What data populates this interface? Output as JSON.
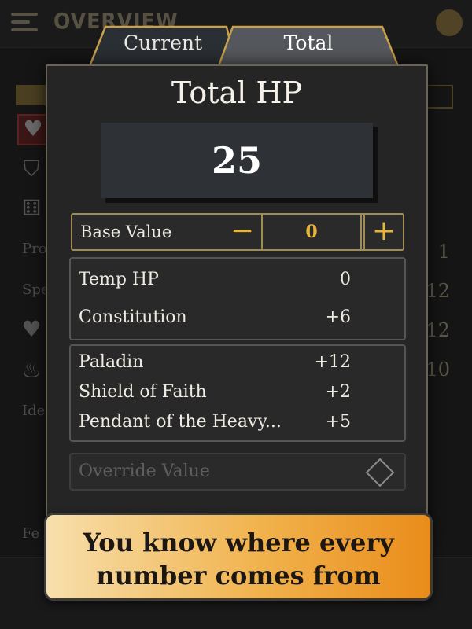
{
  "background": {
    "title": "OVERVIEW",
    "side_texts": [
      "Pro",
      "Spe",
      "Ide",
      "Fe"
    ],
    "side_numbers": [
      "1",
      "12",
      "12",
      "10"
    ]
  },
  "tabs": [
    {
      "label": "Current",
      "active": false
    },
    {
      "label": "Total",
      "active": true
    }
  ],
  "modal": {
    "title": "Total HP",
    "total_value": "25",
    "base": {
      "label": "Base Value",
      "value": "0",
      "minus": "−",
      "plus": "+"
    },
    "group1": [
      {
        "label": "Temp HP",
        "value": "0"
      },
      {
        "label": "Constitution",
        "value": "+6"
      }
    ],
    "group2": [
      {
        "label": "Paladin",
        "value": "+12"
      },
      {
        "label": "Shield of Faith",
        "value": "+2"
      },
      {
        "label": "Pendant of the Heavy...",
        "value": "+5"
      }
    ],
    "override_label": "Override Value"
  },
  "banner": {
    "line1": "You know where every",
    "line2": "number comes from"
  },
  "colors": {
    "accent": "#e6b53a",
    "modal_bg": "#252525",
    "banner_start": "#f7dfac",
    "banner_end": "#ea8c1a"
  }
}
